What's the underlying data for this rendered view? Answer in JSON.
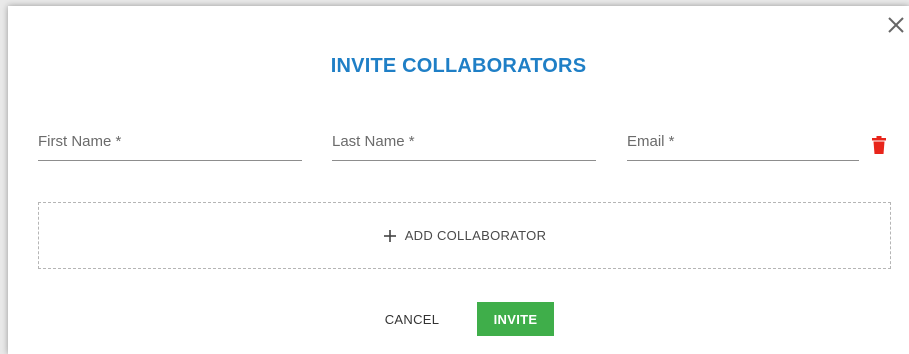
{
  "dialog": {
    "title": "INVITE COLLABORATORS",
    "title_color": "#1f7fc6"
  },
  "form": {
    "first_name_placeholder": "First Name *",
    "last_name_placeholder": "Last Name *",
    "email_placeholder": "Email *",
    "first_name_value": "",
    "last_name_value": "",
    "email_value": ""
  },
  "icons": {
    "close": "close-icon",
    "delete": "trash-icon",
    "add": "plus-icon",
    "delete_color": "#e8251b"
  },
  "add_collaborator": {
    "label": "ADD COLLABORATOR"
  },
  "footer": {
    "cancel_label": "CANCEL",
    "invite_label": "INVITE",
    "invite_color": "#3fae4a"
  }
}
